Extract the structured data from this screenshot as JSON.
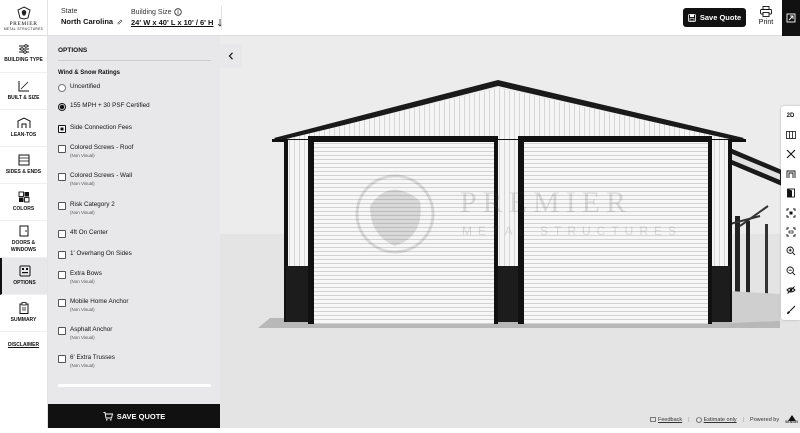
{
  "brand": {
    "name": "PREMIER",
    "tagline": "METAL STRUCTURES"
  },
  "header": {
    "state_label": "State",
    "state_value": "North Carolina",
    "size_label": "Building Size",
    "size_value": "24' W x 40' L x 10' / 6' H",
    "save_quote": "Save Quote",
    "print": "Print"
  },
  "nav": {
    "items": [
      {
        "label": "BUILDING TYPE",
        "icon": "sliders-icon"
      },
      {
        "label": "BUILT & SIZE",
        "icon": "measure-icon"
      },
      {
        "label": "LEAN-TOS",
        "icon": "lean-to-icon"
      },
      {
        "label": "SIDES & ENDS",
        "icon": "sides-icon"
      },
      {
        "label": "COLORS",
        "icon": "palette-icon"
      },
      {
        "label": "DOORS & WINDOWS",
        "icon": "door-icon"
      },
      {
        "label": "OPTIONS",
        "icon": "options-icon"
      },
      {
        "label": "SUMMARY",
        "icon": "clipboard-icon"
      }
    ],
    "disclaimer": "DISCLAIMER",
    "active": "OPTIONS"
  },
  "panel": {
    "title": "OPTIONS",
    "section": "Wind & Snow Ratings",
    "radios": [
      {
        "label": "Uncertified",
        "selected": false
      },
      {
        "label": "155 MPH + 30 PSF Certified",
        "selected": true
      }
    ],
    "checks": [
      {
        "label": "Side Connection Fees",
        "note": "",
        "checked": true
      },
      {
        "label": "Colored Screws - Roof",
        "note": "(Non Visual)",
        "checked": false
      },
      {
        "label": "Colored Screws - Wall",
        "note": "(Non Visual)",
        "checked": false
      },
      {
        "label": "Risk Category 2",
        "note": "(Non Visual)",
        "checked": false
      },
      {
        "label": "4ft On Center",
        "note": "",
        "checked": false
      },
      {
        "label": "1' Overhang On Sides",
        "note": "",
        "checked": false
      },
      {
        "label": "Extra Bows",
        "note": "(Non Visual)",
        "checked": false
      },
      {
        "label": "Mobile Home Anchor",
        "note": "(Non Visual)",
        "checked": false
      },
      {
        "label": "Asphalt Anchor",
        "note": "(Non Visual)",
        "checked": false
      },
      {
        "label": "6' Extra Trusses",
        "note": "(Non Visual)",
        "checked": false
      }
    ],
    "save_quote": "SAVE QUOTE"
  },
  "viewer": {
    "watermark_line1": "PREMIER",
    "watermark_line2": "METAL STRUCTURES",
    "tools": [
      "2D",
      "bays-icon",
      "wrench-icon",
      "frame-icon",
      "door-open-icon",
      "focus-icon",
      "fit-icon",
      "zoom-in-icon",
      "zoom-out-icon",
      "hide-icon",
      "brush-icon"
    ],
    "tool_2d_label": "2D"
  },
  "footer": {
    "feedback": "Feedback",
    "estimate": "Estimate only",
    "powered_by": "Powered by",
    "powered_brand": "SENSEI"
  },
  "colors": {
    "accent": "#111111",
    "panel_bg": "#e8e8ea",
    "scene_bg": "#ececec",
    "trim": "#1c1c1c"
  }
}
